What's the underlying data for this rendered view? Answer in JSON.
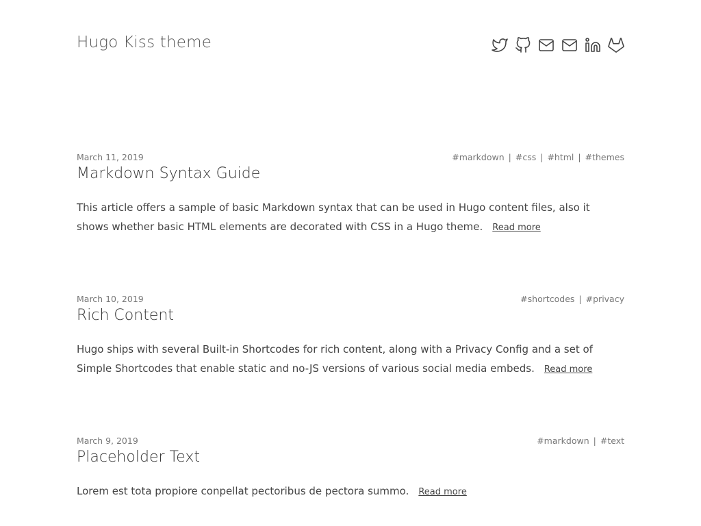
{
  "site": {
    "title": "Hugo Kiss theme"
  },
  "social": [
    {
      "name": "twitter-icon"
    },
    {
      "name": "github-icon"
    },
    {
      "name": "email-icon"
    },
    {
      "name": "email-icon"
    },
    {
      "name": "linkedin-icon"
    },
    {
      "name": "gitlab-icon"
    }
  ],
  "posts": [
    {
      "date": "March 11, 2019",
      "title": "Markdown Syntax Guide",
      "tags": [
        "#markdown",
        "#css",
        "#html",
        "#themes"
      ],
      "summary": "This article offers a sample of basic Markdown syntax that can be used in Hugo content files, also it shows whether basic HTML elements are decorated with CSS in a Hugo theme.",
      "read_more": "Read more"
    },
    {
      "date": "March 10, 2019",
      "title": "Rich Content",
      "tags": [
        "#shortcodes",
        "#privacy"
      ],
      "summary": "Hugo ships with several Built-in Shortcodes for rich content, along with a Privacy Config and a set of Simple Shortcodes that enable static and no-JS versions of various social media embeds.",
      "read_more": "Read more"
    },
    {
      "date": "March 9, 2019",
      "title": "Placeholder Text",
      "tags": [
        "#markdown",
        "#text"
      ],
      "summary": "Lorem est tota propiore conpellat pectoribus de pectora summo.",
      "read_more": "Read more"
    }
  ],
  "tag_separator": "|"
}
